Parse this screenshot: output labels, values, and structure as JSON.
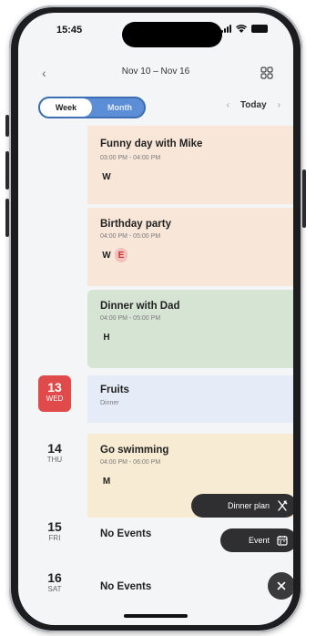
{
  "status": {
    "time": "15:45"
  },
  "header": {
    "range": "Nov 10 – Nov 16",
    "back_icon": "chevron-left-icon",
    "grid_icon": "grid-icon"
  },
  "controls": {
    "week_label": "Week",
    "month_label": "Month",
    "prev_icon": "chevron-left-icon",
    "today_label": "Today",
    "next_icon": "chevron-right-icon"
  },
  "events": [
    {
      "title": "Funny day with Mike",
      "time": "03:00 PM - 04:00 PM",
      "tags": [
        "W"
      ],
      "color": "#f8e6d8"
    },
    {
      "title": "Birthday party",
      "time": "04:00 PM - 05:00 PM",
      "tags": [
        "W",
        "E"
      ],
      "color": "#f8e6d8"
    },
    {
      "title": "Dinner with Dad",
      "time": "04:00 PM - 05:00 PM",
      "tags": [
        "H"
      ],
      "color": "#d6e4d4"
    },
    {
      "title": "Fruits",
      "time": "Dinner",
      "tags": [],
      "color": "#e6ecf7"
    },
    {
      "title": "Go swimming",
      "time": "04:00 PM - 06:00 PM",
      "tags": [
        "M"
      ],
      "color": "#f8ebd3"
    }
  ],
  "days": [
    {
      "day": "13",
      "weekday": "WED",
      "selected": true
    },
    {
      "day": "14",
      "weekday": "THU",
      "selected": false
    },
    {
      "day": "15",
      "weekday": "FRI",
      "selected": false
    },
    {
      "day": "16",
      "weekday": "SAT",
      "selected": false
    }
  ],
  "no_events_label": "No Events",
  "fab": {
    "dinner_label": "Dinner plan",
    "dinner_icon": "utensils-icon",
    "event_label": "Event",
    "event_icon": "calendar-icon",
    "close_icon": "close-icon"
  },
  "colors": {
    "accent": "#5b8ed6",
    "selected_day": "#e04a4a",
    "fab": "#2f2f31"
  }
}
